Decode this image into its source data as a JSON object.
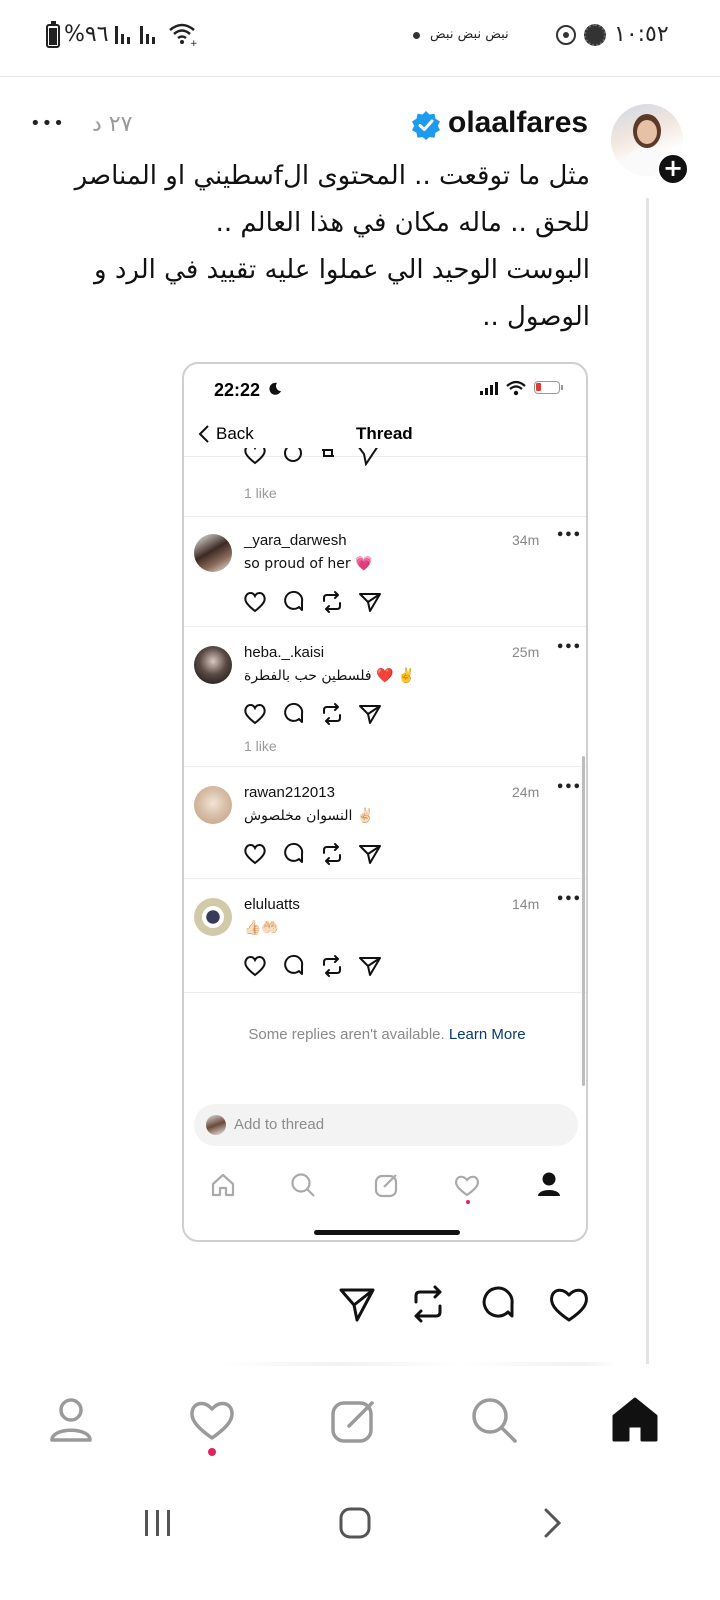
{
  "status_bar": {
    "time": "١٠:٥٢",
    "notification_text": "نبض نبض نبض",
    "battery": "%٩٦"
  },
  "post": {
    "username": "olaalfares",
    "time_ago": "٢٧ د",
    "more": "•••",
    "text_lines": [
      "مثل ما توقعت .. المحتوى الfسطيني  او المناصر",
      "للحق .. ماله مكان في هذا العالم ..",
      "البوست الوحيد الي عملوا عليه تقييد في الرد و",
      "الوصول .."
    ]
  },
  "embed": {
    "time": "22:22",
    "back_label": "Back",
    "title": "Thread",
    "top_like": "1 like",
    "replies": [
      {
        "user": "_yara_darwesh",
        "time": "34m",
        "text": "so proud of her 💗",
        "likes": ""
      },
      {
        "user": "heba._.kaisi",
        "time": "25m",
        "text": "فلسطين حب بالفطرة ❤️ ✌️",
        "likes": "1 like"
      },
      {
        "user": "rawan212013",
        "time": "24m",
        "text": "النسوان مخلصوش ✌🏻",
        "likes": ""
      },
      {
        "user": "eluluatts",
        "time": "14m",
        "text": "👍🏻🤲🏻",
        "likes": ""
      }
    ],
    "unavailable_text": "Some replies aren't available.",
    "learn_more": "Learn More",
    "add_placeholder": "Add to thread"
  },
  "colors": {
    "verified": "#1d9bf0",
    "notification_dot": "#e0245e",
    "learn_more": "#0a3a6e"
  }
}
